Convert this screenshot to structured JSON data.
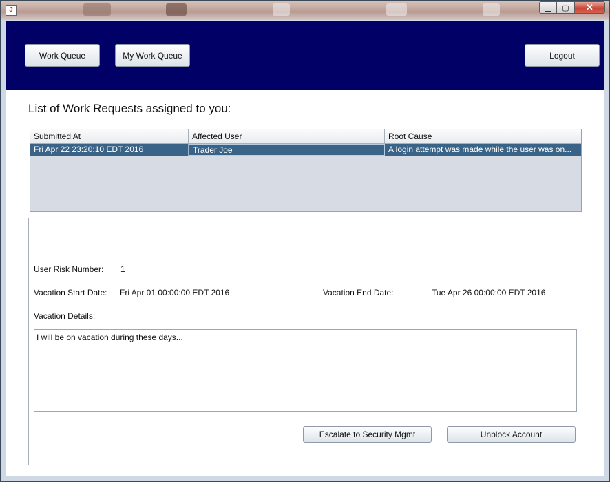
{
  "window": {
    "close_glyph": "✕",
    "min_glyph": "▁",
    "max_glyph": "▢",
    "app_icon": "java-icon"
  },
  "header": {
    "work_queue_label": "Work Queue",
    "my_work_queue_label": "My Work Queue",
    "logout_label": "Logout"
  },
  "page_title": "List of Work Requests assigned to you:",
  "table": {
    "columns": [
      "Submitted At",
      "Affected User",
      "Root Cause"
    ],
    "rows": [
      [
        "Fri Apr 22 23:20:10 EDT 2016",
        "Trader Joe",
        "A login attempt was made while the user was on..."
      ]
    ]
  },
  "details": {
    "risk_label": "User Risk Number:",
    "risk_value": "1",
    "start_label": "Vacation Start Date:",
    "start_value": "Fri Apr 01 00:00:00 EDT 2016",
    "end_label": "Vacation End Date:",
    "end_value": "Tue Apr 26 00:00:00 EDT 2016",
    "details_label": "Vacation Details:",
    "details_text": "I will be on vacation during these days..."
  },
  "actions": {
    "escalate_label": "Escalate to Security Mgmt",
    "unblock_label": "Unblock Account"
  },
  "colors": {
    "header_bg": "#010066",
    "selected_row": "#3a6487",
    "table_bg": "#d7dbe3"
  }
}
